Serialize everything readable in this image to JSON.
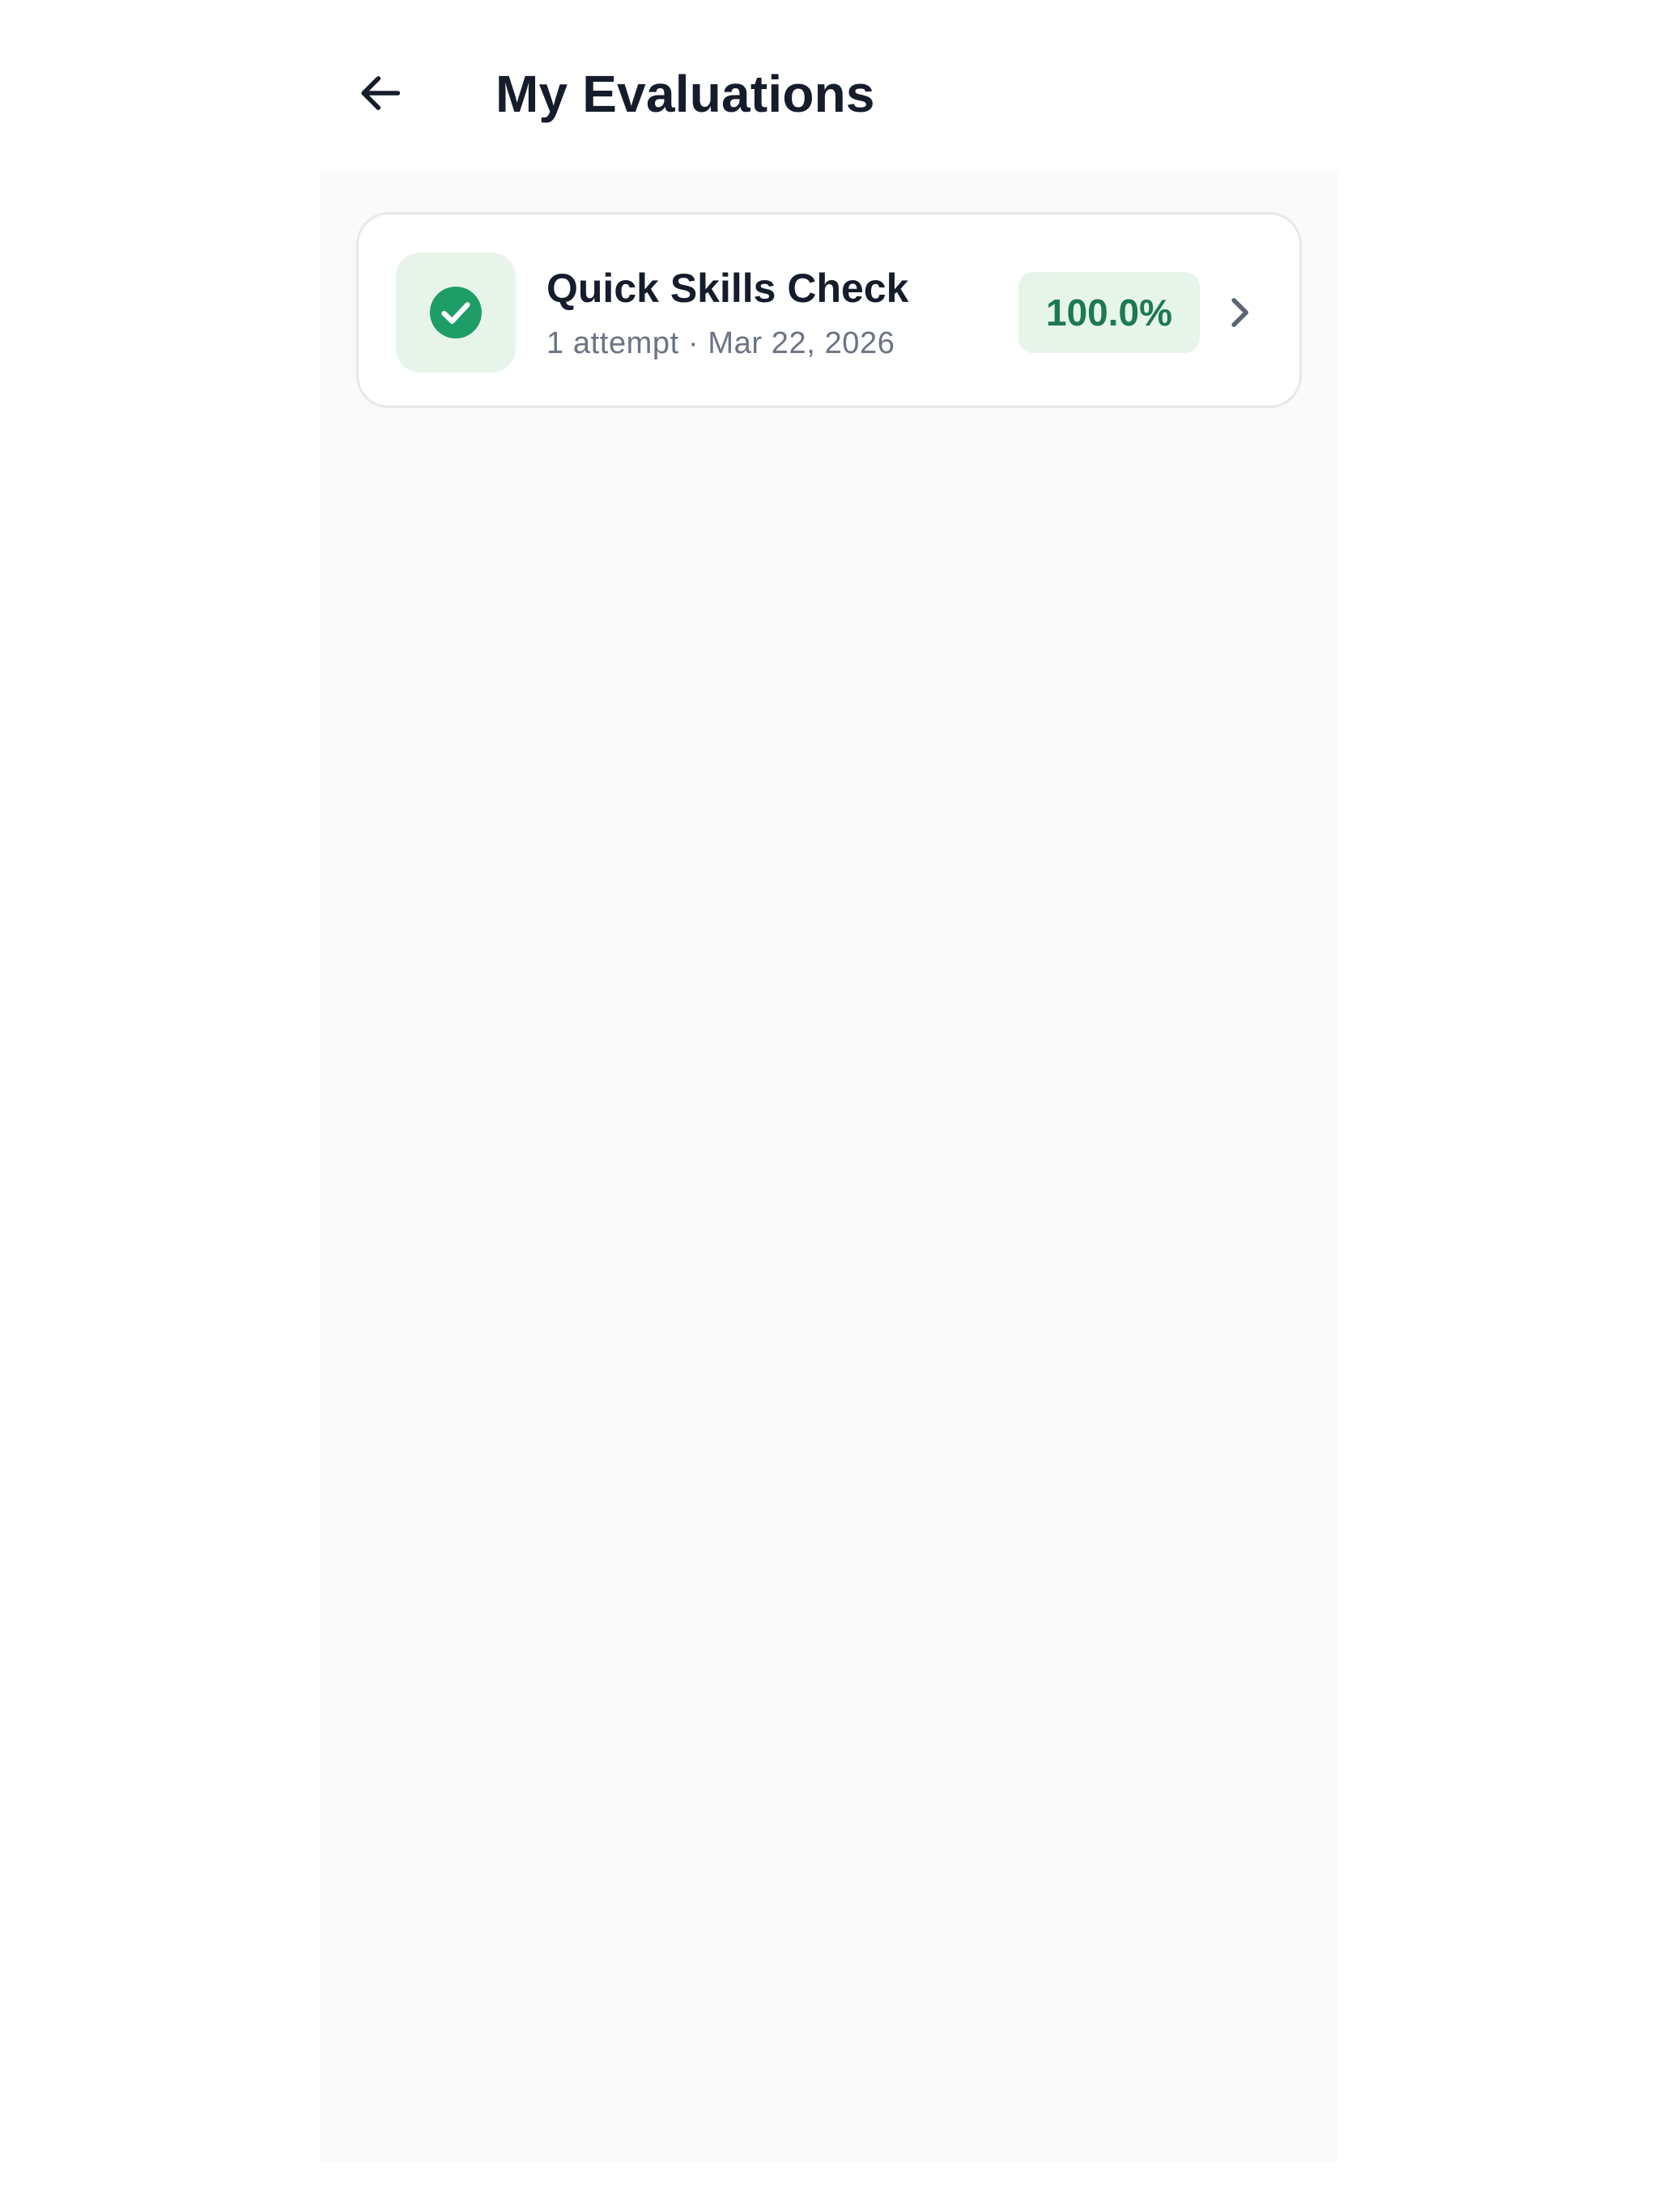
{
  "header": {
    "back_icon": "arrow-left-icon",
    "title": "My Evaluations"
  },
  "evaluations": [
    {
      "title": "Quick Skills Check",
      "meta": "1 attempt · Mar 22, 2026",
      "score": "100.0%",
      "status_icon": "check-circle-icon",
      "open_icon": "chevron-right-icon"
    }
  ],
  "colors": {
    "accent_green": "#1f9d66",
    "badge_background": "#e6f4e9",
    "badge_text": "#1d7a4e",
    "title_text": "#151c2b",
    "meta_text": "#6b7384"
  }
}
